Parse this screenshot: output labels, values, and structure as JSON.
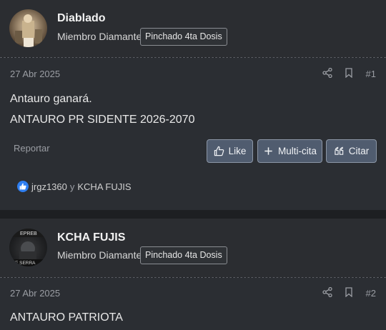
{
  "posts": [
    {
      "username": "Diablado",
      "user_title": "Miembro Diamante",
      "badge": "Pinchado 4ta Dosis",
      "date": "27 Abr 2025",
      "post_number": "#1",
      "content": [
        "Antauro ganará.",
        "ANTAURO PR SIDENTE 2026-2070"
      ],
      "report_label": "Reportar",
      "buttons": {
        "like": "Like",
        "multi_quote": "Multi-cita",
        "quote": "Citar"
      },
      "reactions": {
        "user1": "jrgz1360",
        "conjunction": "y",
        "user2": "KCHA FUJIS",
        "icon": "thumbs-up-icon"
      }
    },
    {
      "username": "KCHA FUJIS",
      "user_title": "Miembro Diamante",
      "badge": "Pinchado 4ta Dosis",
      "avatar_text_top": "EPREB",
      "avatar_text_bottom": "TE SERRA",
      "date": "27 Abr 2025",
      "post_number": "#2",
      "content": [
        "ANTAURO PATRIOTA"
      ]
    }
  ],
  "colors": {
    "button_bg": "#505c6f",
    "reaction_blue": "#2e7ef0",
    "background": "#1d1f22"
  }
}
